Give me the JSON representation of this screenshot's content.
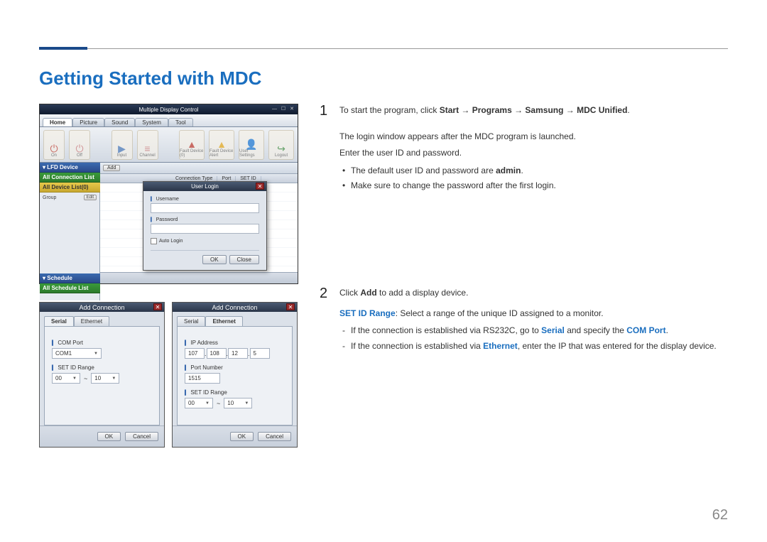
{
  "page": {
    "title": "Getting Started with MDC",
    "number": "62"
  },
  "mdc": {
    "windowTitle": "Multiple Display Control",
    "tabs": [
      "Home",
      "Picture",
      "Sound",
      "System",
      "Tool"
    ],
    "ribbonLeft": [
      {
        "label": "On"
      },
      {
        "label": "Off"
      }
    ],
    "ribbonMid": [
      {
        "label": "Input"
      },
      {
        "label": "Channel"
      }
    ],
    "ribbonRight": [
      {
        "label": "Fault Device (0)"
      },
      {
        "label": "Fault Device Alert"
      },
      {
        "label": "User Settings"
      },
      {
        "label": "Logout"
      }
    ],
    "side": {
      "lfd": "LFD Device",
      "allConn": "All Connection List",
      "allDevice": "All Device List(0)",
      "group": "Group",
      "edit": "Edit",
      "schedule": "Schedule",
      "allSched": "All Schedule List"
    },
    "toolbar": {
      "add": "Add"
    },
    "gridHeaders": [
      "Connection Type",
      "Port",
      "SET ID"
    ],
    "login": {
      "title": "User Login",
      "username": "Username",
      "password": "Password",
      "auto": "Auto Login",
      "ok": "OK",
      "close": "Close"
    }
  },
  "dialog": {
    "title": "Add Connection",
    "tabs": {
      "serial": "Serial",
      "ethernet": "Ethernet"
    },
    "serial": {
      "comPortLabel": "COM Port",
      "comPortValue": "COM1",
      "setIdLabel": "SET ID Range",
      "from": "00",
      "to": "10"
    },
    "ethernet": {
      "ipLabel": "IP Address",
      "ip": [
        "107",
        "108",
        "12",
        "5"
      ],
      "portLabel": "Port Number",
      "portValue": "1515",
      "setIdLabel": "SET ID Range",
      "from": "00",
      "to": "10"
    },
    "ok": "OK",
    "cancel": "Cancel",
    "tilde": "~"
  },
  "steps": {
    "s1": {
      "num": "1",
      "lead_a": "To start the program, click ",
      "lead_b": "Start → Programs → Samsung → MDC Unified",
      "lead_c": ".",
      "p2": "The login window appears after the MDC program is launched.",
      "p3": "Enter the user ID and password.",
      "b1a": "The default user ID and password are ",
      "b1b": "admin",
      "b1c": ".",
      "b2": "Make sure to change the password after the first login."
    },
    "s2": {
      "num": "2",
      "lead_a": "Click ",
      "lead_b": "Add",
      "lead_c": " to add a display device.",
      "p2a": "SET ID Range",
      "p2b": ": Select a range of the unique ID assigned to a monitor.",
      "d1a": "If the connection is established via RS232C, go to ",
      "d1b": "Serial",
      "d1c": " and specify the ",
      "d1d": "COM Port",
      "d1e": ".",
      "d2a": "If the connection is established via ",
      "d2b": "Ethernet",
      "d2c": ", enter the IP that was entered for the display device."
    }
  }
}
